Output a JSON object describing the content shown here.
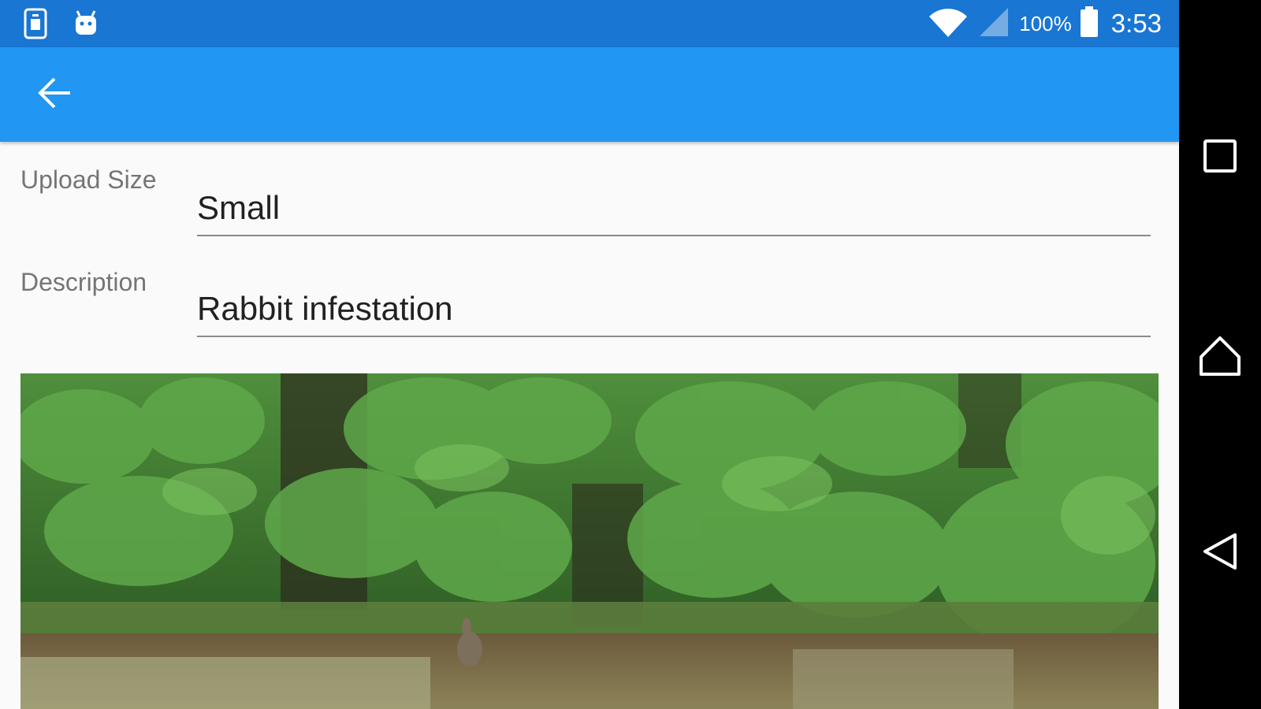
{
  "status_bar": {
    "battery_percent": "100%",
    "time": "3:53",
    "icons": [
      "sim-card-icon",
      "android-icon",
      "wifi-icon",
      "signal-icon",
      "battery-icon"
    ]
  },
  "app_bar": {
    "back_icon": "arrow-back-icon",
    "color": "#2196f3"
  },
  "form": {
    "upload_size": {
      "label": "Upload Size",
      "value": "Small"
    },
    "description": {
      "label": "Description",
      "value": "Rabbit infestation"
    }
  },
  "photo": {
    "icon": "photo-image"
  },
  "nav_bar": {
    "icons": [
      "recents-square-icon",
      "home-icon",
      "back-triangle-icon"
    ]
  },
  "colors": {
    "status_bar": "#1976d2",
    "app_bar": "#2196f3",
    "background": "#fafafa"
  }
}
